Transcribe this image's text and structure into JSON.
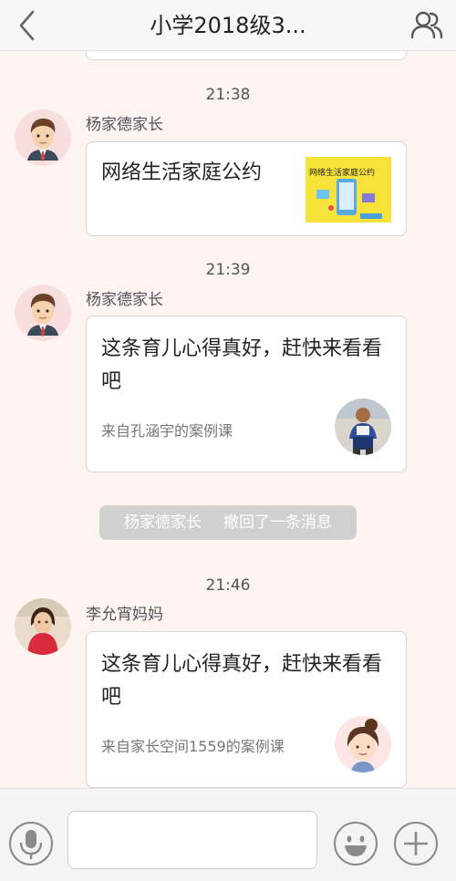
{
  "header": {
    "title": "小学2018级3...",
    "back_icon": "chevron-left-icon",
    "members_icon": "group-members-icon"
  },
  "messages": [
    {
      "time": "21:38",
      "sender": "杨家德家长",
      "card_title": "网络生活家庭公约",
      "thumb_text": "网络生活家庭公约"
    },
    {
      "time": "21:39",
      "sender": "杨家德家长",
      "card_title": "这条育儿心得真好，赶快来看看吧",
      "card_source": "来自孔涵宇的案例课"
    },
    {
      "time": "21:46",
      "sender": "李允宵妈妈",
      "card_title": "这条育儿心得真好，赶快来看看吧",
      "card_source": "来自家长空间1559的案例课"
    }
  ],
  "recall": {
    "name": "杨家德家长",
    "text": "撤回了一条消息"
  },
  "input_bar": {
    "voice_icon": "microphone-icon",
    "emoji_icon": "emoji-icon",
    "plus_icon": "plus-icon",
    "input_value": ""
  },
  "colors": {
    "background": "#fcf4f0",
    "card_border": "#d6d6d6",
    "recall_bg": "#d0d0d0"
  }
}
